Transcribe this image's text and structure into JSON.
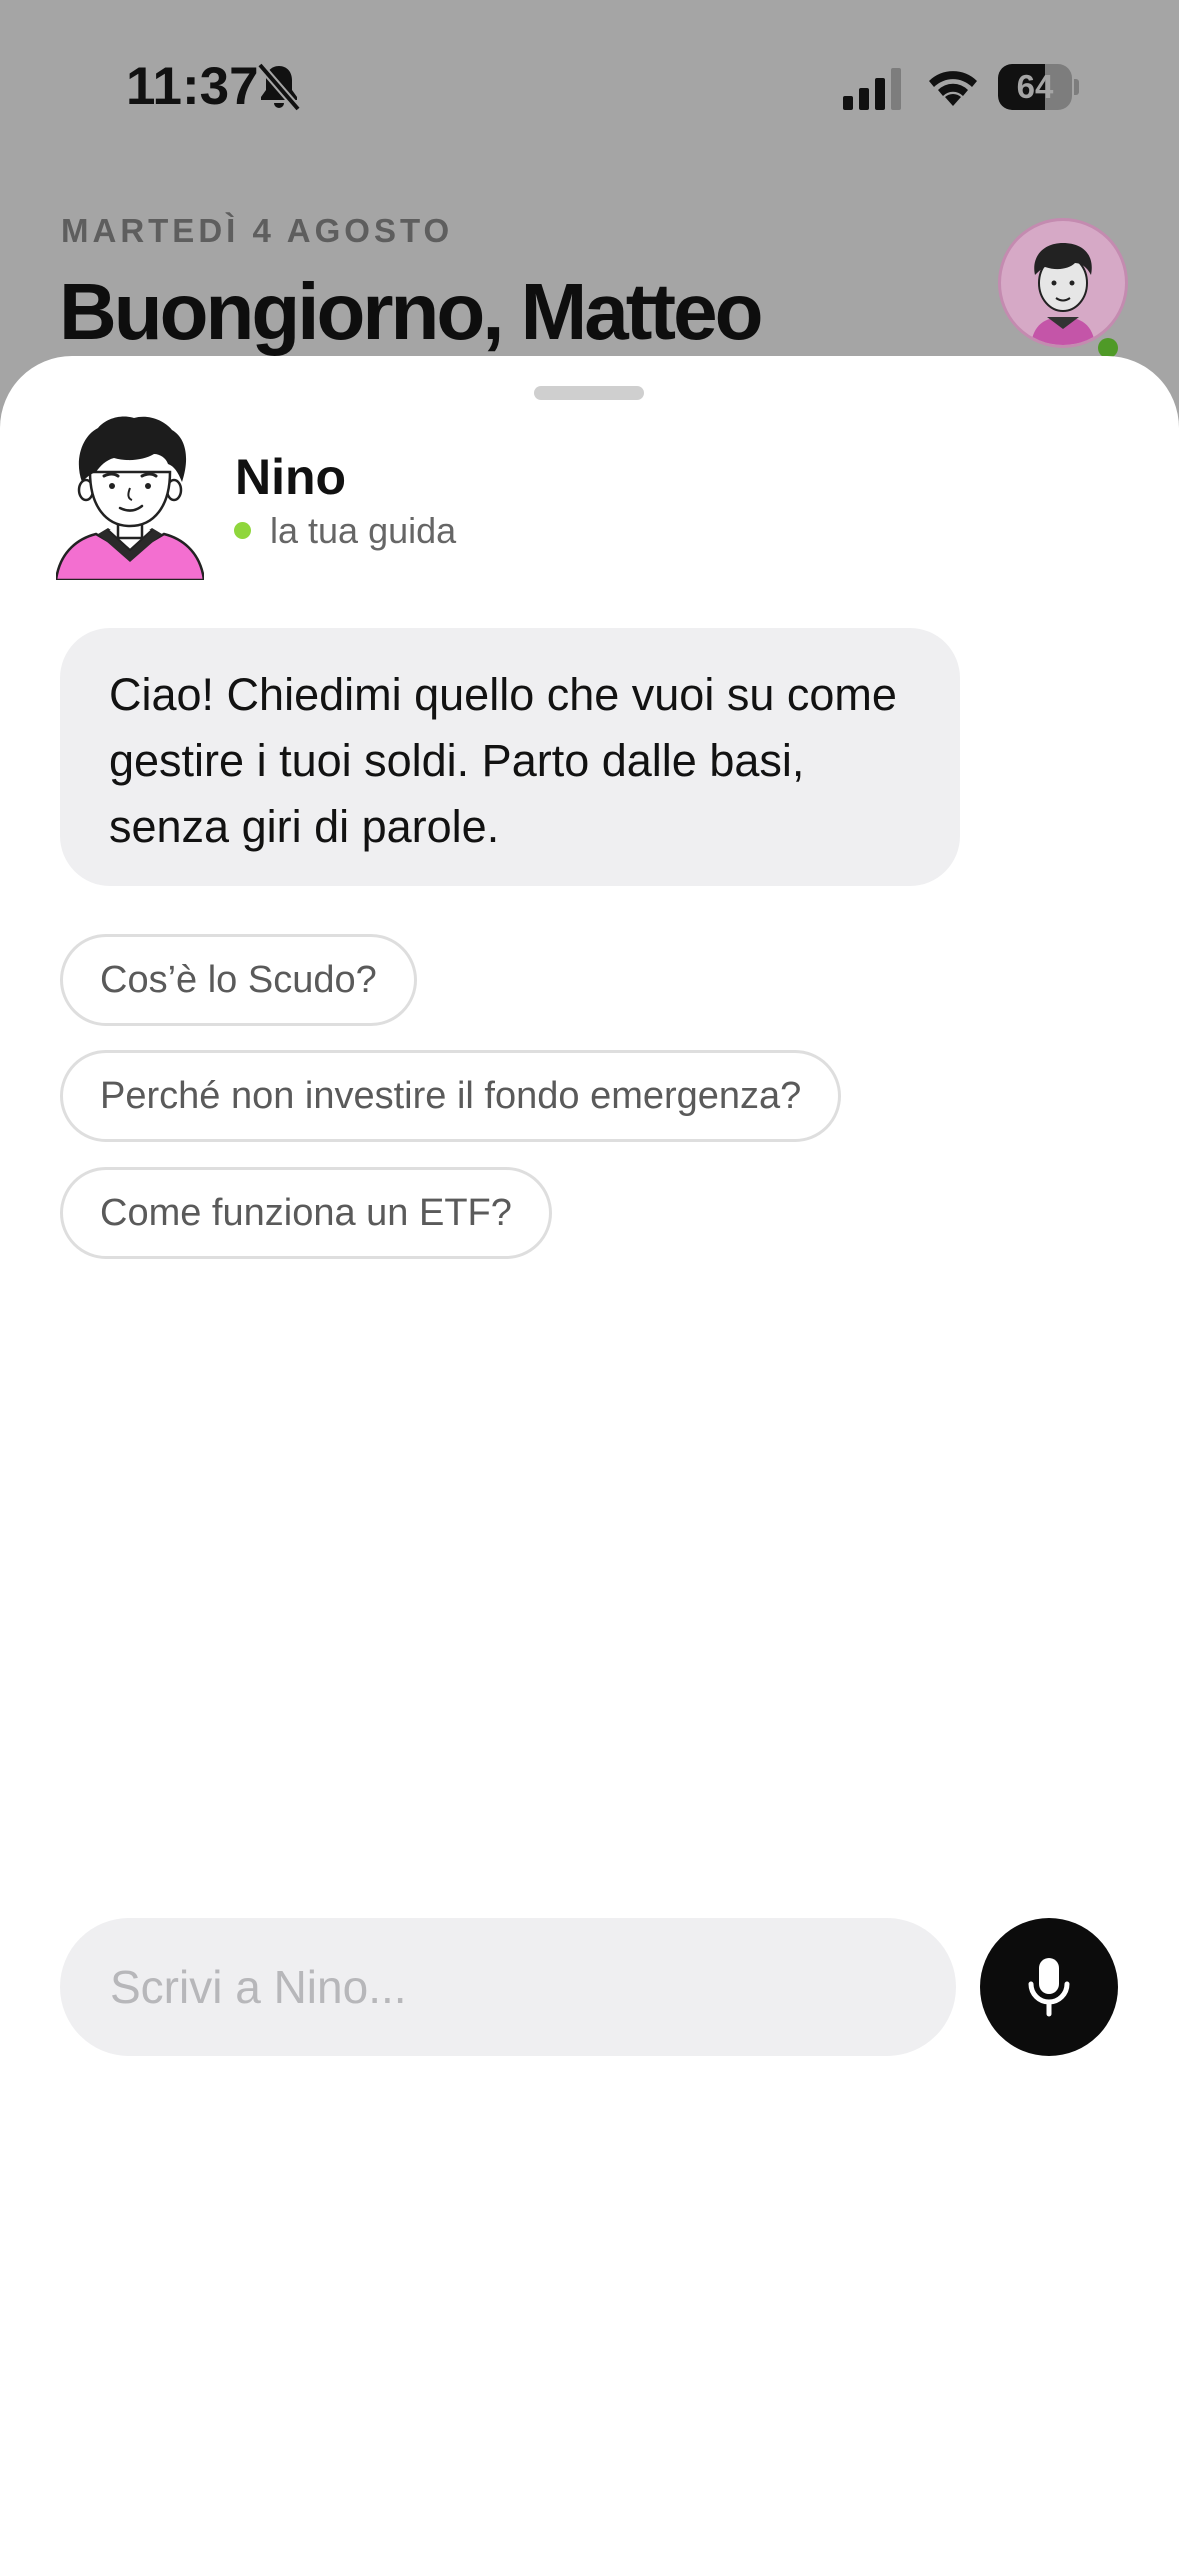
{
  "status_bar": {
    "time": "11:37",
    "battery_level": "64",
    "icons": [
      "bell-slash-icon",
      "cellular-signal-icon",
      "wifi-icon",
      "battery-icon"
    ]
  },
  "home": {
    "date": "MARTEDÌ 4 AGOSTO",
    "greeting": "Buongiorno, Matteo"
  },
  "chat": {
    "assistant_name": "Nino",
    "assistant_status": "la tua guida",
    "status_color": "#8fd63c",
    "greeting_message": "Ciao! Chiedimi quello che vuoi su come gestire i tuoi soldi. Parto dalle basi, senza giri di parole.",
    "suggestions": [
      "Cos’è lo Scudo?",
      "Perché non investire il fondo emergenza?",
      "Come funziona un ETF?"
    ],
    "input_placeholder": "Scrivi a Nino..."
  },
  "colors": {
    "sheet_background": "#ffffff",
    "dimmed_background": "#a5a5a5",
    "bubble_background": "#efeff1",
    "mic_button": "#0c0c0c",
    "avatar_hoodie": "#f36fd0"
  }
}
